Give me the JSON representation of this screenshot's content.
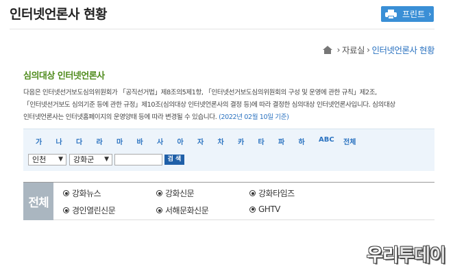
{
  "header": {
    "title": "인터넷언론사 현황",
    "print_label": "프린트",
    "print_chevron": "›"
  },
  "breadcrumb": {
    "sep1": "›",
    "item1": "자료실",
    "sep2": "›",
    "current": "인터넷언론사 현황"
  },
  "section": {
    "title": "심의대상 인터넷언론사",
    "desc_line1": "다음은 인터넷선거보도심의위원회가 「공직선거법」제8조의5제1항, 「인터넷선거보도심의위원회의 구성 및 운영에 관한 규칙」제2조,",
    "desc_line2": "「인터넷선거보도 심의기준 등에 관한 규정」제10조(심의대상 인터넷언론사의 결정 등)에 따라 결정한 심의대상 인터넷언론사입니다. 심의대상",
    "desc_line3": "인터넷언론사는 인터넷홈페이지의 운영양태 등에 따라 변경될 수 있습니다.",
    "desc_date": "(2022년 02월 10일 기준)"
  },
  "filter": {
    "letters": [
      "가",
      "나",
      "다",
      "라",
      "마",
      "바",
      "사",
      "아",
      "자",
      "차",
      "카",
      "타",
      "파",
      "하",
      "ABC",
      "전체"
    ],
    "region": "인천",
    "district": "강화군",
    "search_value": "",
    "search_label": "검 색"
  },
  "list": {
    "head": "전체",
    "items": [
      "강화뉴스",
      "강화신문",
      "강화타임즈",
      "경인열린신문",
      "서해문화신문",
      "GHTV"
    ]
  },
  "watermark": {
    "part1": "우리",
    "part2": "투데이"
  }
}
